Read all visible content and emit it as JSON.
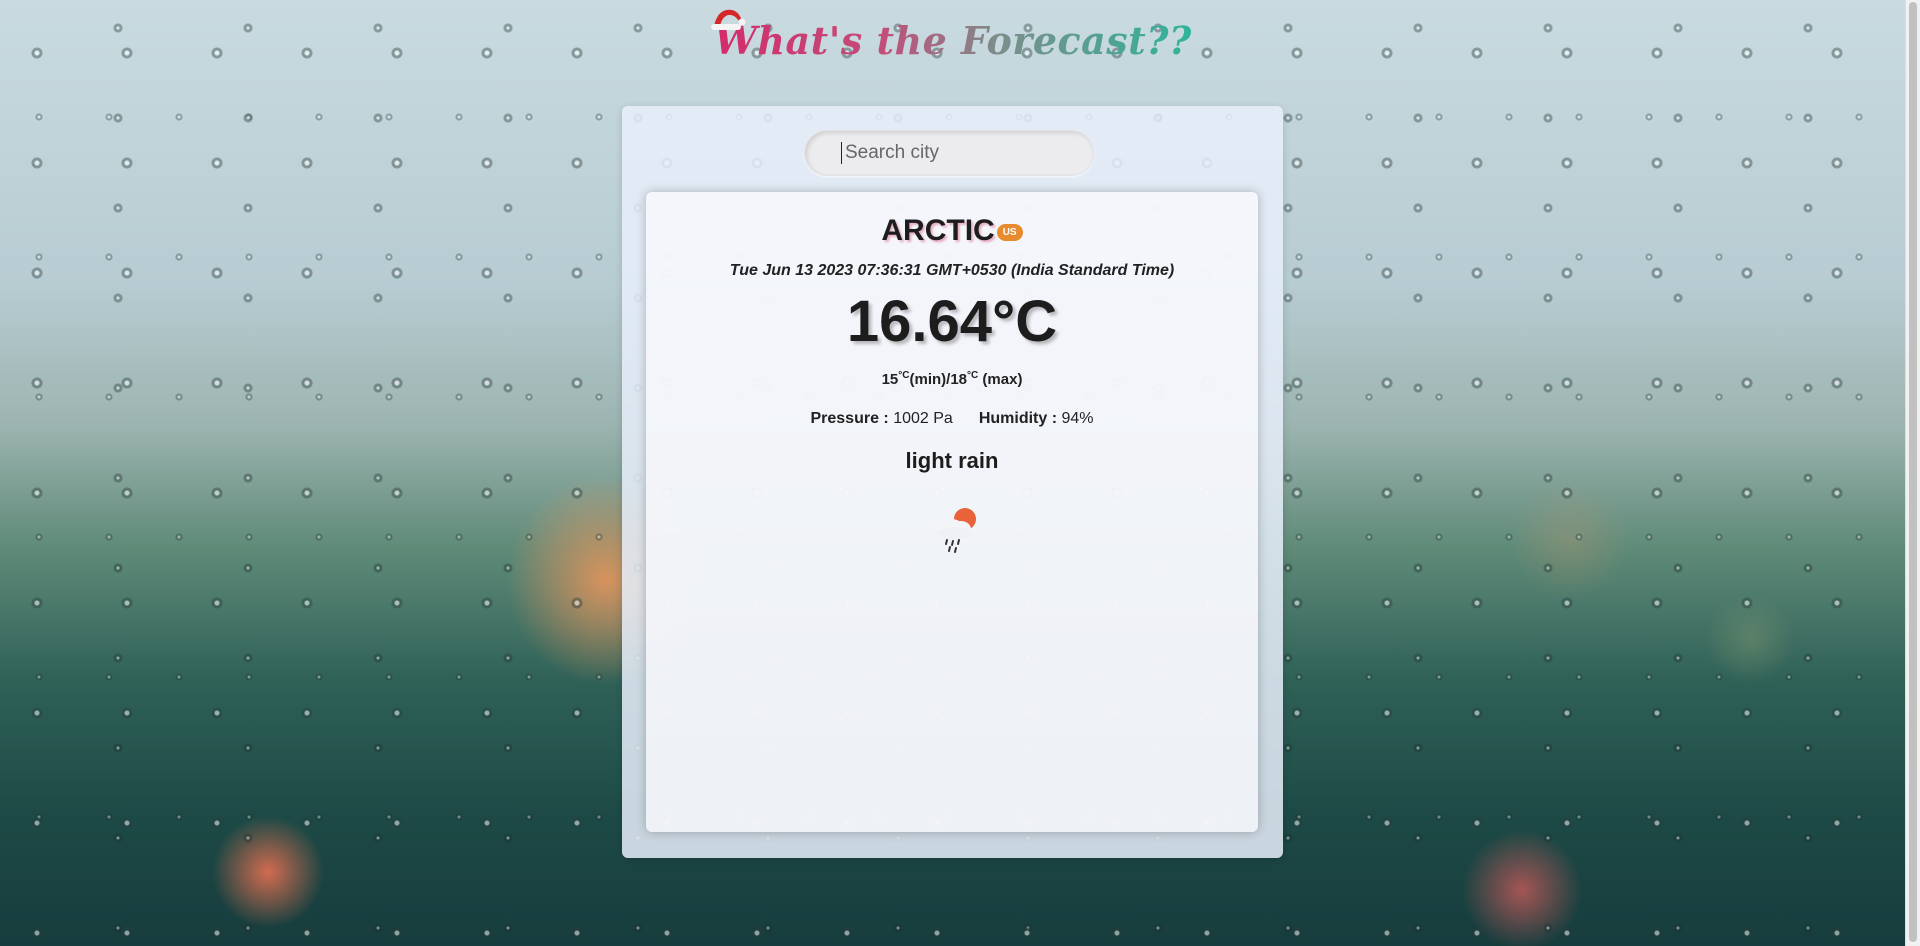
{
  "header": {
    "title": "What's the Forecast??"
  },
  "search": {
    "placeholder": "Search city",
    "value": ""
  },
  "weather": {
    "city": "ARCTIC",
    "country": "US",
    "datetime": "Tue Jun 13 2023 07:36:31 GMT+0530 (India Standard Time)",
    "temperature": "16.64°C",
    "min": "15",
    "max": "18",
    "unit": "°C",
    "min_label": "(min)",
    "max_label": "(max)",
    "separator": "/",
    "pressure_label": "Pressure :",
    "pressure_value": "1002 Pa",
    "humidity_label": "Humidity :",
    "humidity_value": "94%",
    "description": "light rain",
    "icon": "sun-cloud-rain-icon"
  },
  "colors": {
    "title_start": "#d42b6a",
    "title_end": "#2fb39a",
    "country_badge": "#e88a2e"
  }
}
